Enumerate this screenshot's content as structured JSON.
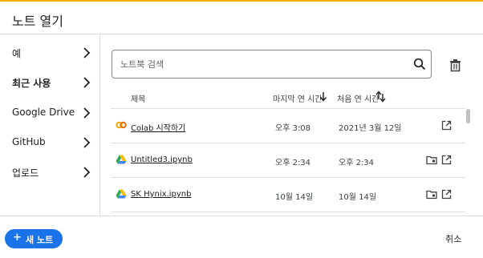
{
  "dialog": {
    "title": "노트 열기",
    "accent_color": "#f9ab00"
  },
  "sidebar": {
    "items": [
      {
        "label": "예",
        "active": false
      },
      {
        "label": "최근 사용",
        "active": true
      },
      {
        "label": "Google Drive",
        "active": false
      },
      {
        "label": "GitHub",
        "active": false
      },
      {
        "label": "업로드",
        "active": false
      }
    ]
  },
  "search": {
    "placeholder": "노트북 검색"
  },
  "table": {
    "columns": {
      "title": "제목",
      "last_opened": "마지막 연 시간",
      "first_opened": "처음 연 시간"
    },
    "rows": [
      {
        "icon": "colab-icon",
        "name": "Colab 시작하기",
        "last_opened": "오후 3:08",
        "first_opened": "2021년 3월 12일",
        "actions": [
          "open-in-new-tab-icon"
        ]
      },
      {
        "icon": "google-drive-icon",
        "name": "Untitled3.ipynb",
        "last_opened": "오후 2:34",
        "first_opened": "오후 2:34",
        "actions": [
          "folder-icon",
          "open-in-new-tab-icon"
        ]
      },
      {
        "icon": "google-drive-icon",
        "name": "SK Hynix.ipynb",
        "last_opened": "10월 14일",
        "first_opened": "10월 14일",
        "actions": [
          "folder-icon",
          "open-in-new-tab-icon"
        ]
      }
    ]
  },
  "footer": {
    "new_button": "새 노트",
    "new_button_color": "#1a73e8",
    "cancel_button": "취소"
  }
}
